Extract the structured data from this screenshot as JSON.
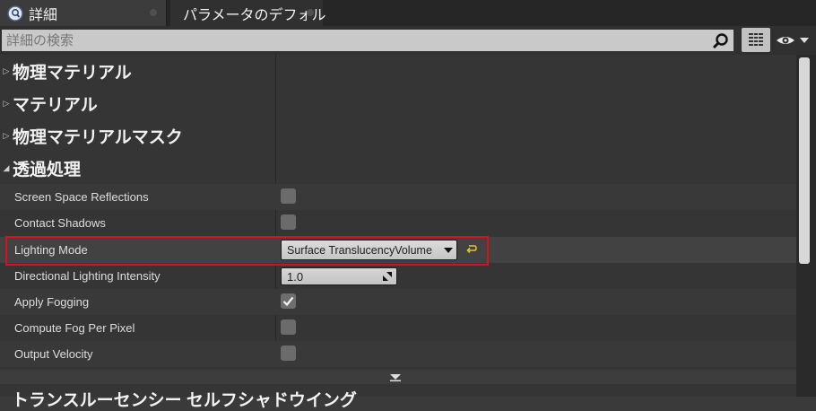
{
  "tabs": [
    {
      "label": "詳細",
      "icon": "details-icon",
      "active": true
    },
    {
      "label": "パラメータのデフォル",
      "icon": "details-icon",
      "active": false
    }
  ],
  "search": {
    "placeholder": "詳細の検索"
  },
  "toolbar": {
    "grid_icon": "grid-view-icon",
    "eye_icon": "eye-visibility-icon"
  },
  "categories": [
    {
      "label": "物理マテリアル",
      "expanded": false
    },
    {
      "label": "マテリアル",
      "expanded": false
    },
    {
      "label": "物理マテリアルマスク",
      "expanded": false
    },
    {
      "label": "透過処理",
      "expanded": true
    }
  ],
  "properties": {
    "ssr": {
      "label": "Screen Space Reflections",
      "checked": false
    },
    "contact_shadows": {
      "label": "Contact Shadows",
      "checked": false
    },
    "lighting_mode": {
      "label": "Lighting Mode",
      "value": "Surface TranslucencyVolume"
    },
    "dir_light": {
      "label": "Directional Lighting Intensity",
      "value": "1.0"
    },
    "apply_fog": {
      "label": "Apply Fogging",
      "checked": true
    },
    "fog_per_pixel": {
      "label": "Compute Fog Per Pixel",
      "checked": false
    },
    "output_velocity": {
      "label": "Output Velocity",
      "checked": false
    }
  },
  "next_category_partial": "トランスルーセンシー セルフシャドウイング",
  "colors": {
    "highlight": "#d4131a",
    "accent_reset": "#e6c428"
  }
}
